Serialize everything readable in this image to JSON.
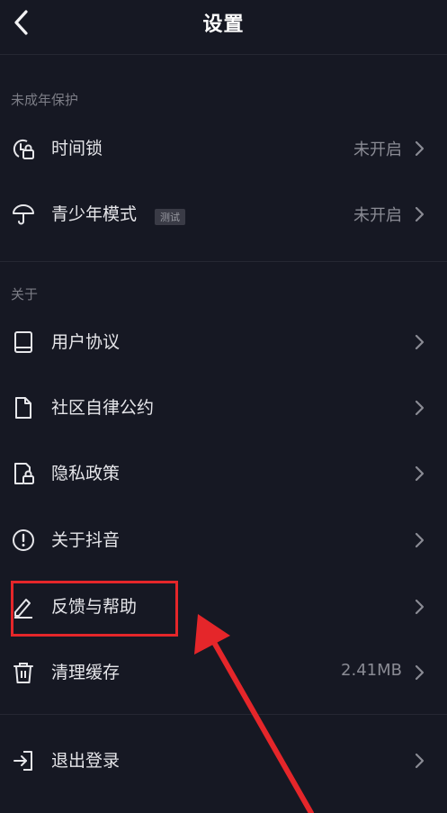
{
  "header": {
    "title": "设置"
  },
  "sections": {
    "minor_protection": "未成年保护",
    "about": "关于"
  },
  "rows": {
    "time_lock": {
      "label": "时间锁",
      "value": "未开启"
    },
    "teen_mode": {
      "label": "青少年模式",
      "badge": "测试",
      "value": "未开启"
    },
    "user_agreement": {
      "label": "用户协议"
    },
    "community": {
      "label": "社区自律公约"
    },
    "privacy": {
      "label": "隐私政策"
    },
    "about_douyin": {
      "label": "关于抖音"
    },
    "feedback": {
      "label": "反馈与帮助"
    },
    "clear_cache": {
      "label": "清理缓存",
      "value": "2.41MB"
    },
    "logout": {
      "label": "退出登录"
    }
  },
  "colors": {
    "background": "#161823",
    "highlight": "#e5262a"
  }
}
